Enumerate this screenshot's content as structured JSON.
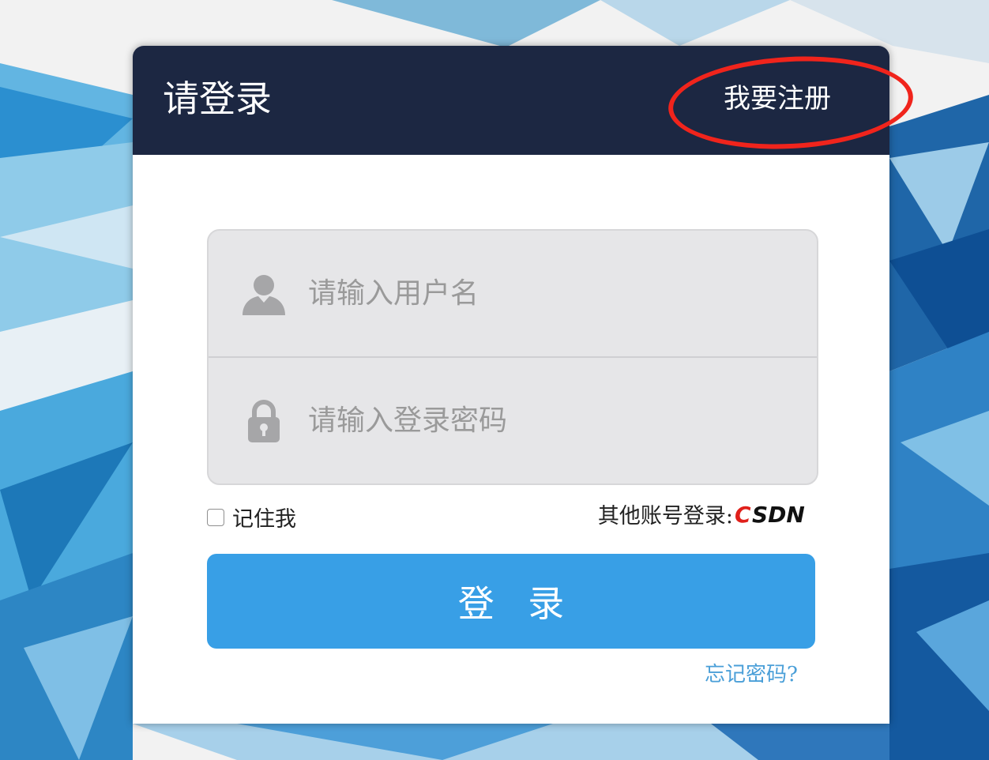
{
  "header": {
    "title": "请登录",
    "register_link": "我要注册"
  },
  "form": {
    "username": {
      "placeholder": "请输入用户名",
      "value": "",
      "icon": "user-icon"
    },
    "password": {
      "placeholder": "请输入登录密码",
      "value": "",
      "icon": "lock-icon"
    },
    "remember_me": {
      "label": "记住我",
      "checked": false
    },
    "other_login": {
      "label": "其他账号登录:",
      "provider": "CSDN"
    },
    "submit_label": "登 录",
    "forgot_password": "忘记密码?"
  },
  "colors": {
    "header_bg": "#1c2742",
    "button_bg": "#389fe6",
    "link": "#4a9fd8",
    "annotation": "#f0241c"
  }
}
